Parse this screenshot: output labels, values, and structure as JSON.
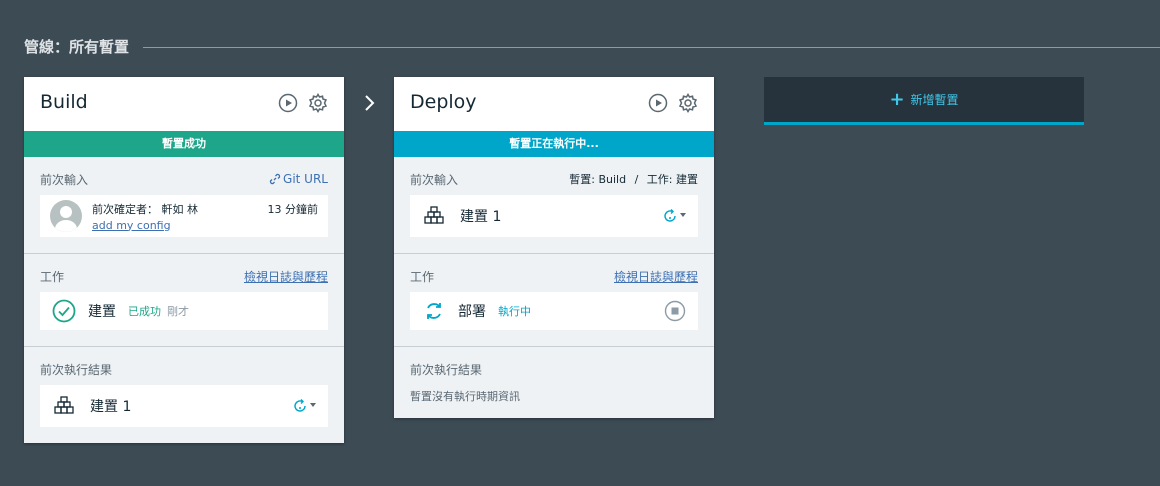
{
  "page": {
    "title": "管線：所有暫置"
  },
  "stages": [
    {
      "name": "Build",
      "status": "暫置成功",
      "status_color": "#1ea68a",
      "last_input": {
        "label": "前次輸入",
        "link": "Git URL",
        "committer": "前次確定者： 軒如 林",
        "time": "13 分鐘前",
        "message": "add my config"
      },
      "jobs": {
        "label": "工作",
        "link": "檢視日誌與歷程",
        "job_name": "建置",
        "job_status": "已成功",
        "job_time": "剛才"
      },
      "last_result": {
        "label": "前次執行結果",
        "build": "建置 1"
      }
    },
    {
      "name": "Deploy",
      "status": "暫置正在執行中...",
      "status_color": "#00a6c9",
      "last_input": {
        "label": "前次輸入",
        "source": "暫置: Build",
        "separator": "/",
        "job": "工作: 建置",
        "build": "建置 1"
      },
      "jobs": {
        "label": "工作",
        "link": "檢視日誌與歷程",
        "job_name": "部署",
        "job_status": "執行中"
      },
      "last_result": {
        "label": "前次執行結果",
        "empty_text": "暫置沒有執行時期資訊"
      }
    }
  ],
  "add_stage": {
    "label": "新增暫置",
    "accent": "#00a6c9"
  },
  "icons": [
    "play-icon",
    "gear-icon",
    "link-icon",
    "check-icon",
    "sync-icon",
    "stop-icon",
    "build-blocks-icon",
    "redeploy-icon",
    "chevron-right-icon",
    "plus-icon"
  ]
}
